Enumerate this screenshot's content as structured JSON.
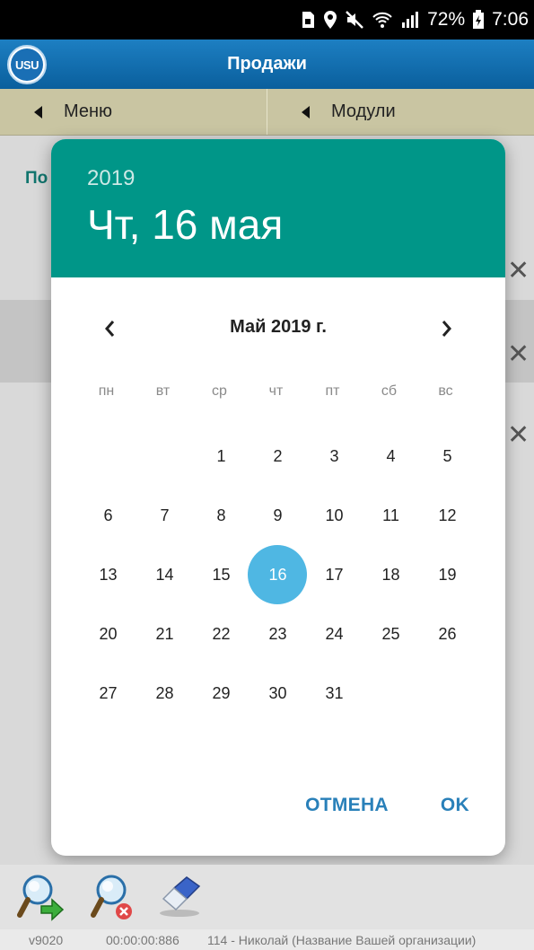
{
  "status_bar": {
    "battery": "72%",
    "time": "7:06"
  },
  "header": {
    "logo_text": "USU",
    "title": "Продажи"
  },
  "nav": {
    "menu_label": "Меню",
    "modules_label": "Модули"
  },
  "background": {
    "label_partial": "По"
  },
  "date_picker": {
    "year": "2019",
    "selected_date_text": "Чт, 16 мая",
    "month_title": "Май 2019 г.",
    "weekdays": [
      "пн",
      "вт",
      "ср",
      "чт",
      "пт",
      "сб",
      "вс"
    ],
    "weeks": [
      [
        "",
        "",
        "1",
        "2",
        "3",
        "4",
        "5"
      ],
      [
        "6",
        "7",
        "8",
        "9",
        "10",
        "11",
        "12"
      ],
      [
        "13",
        "14",
        "15",
        "16",
        "17",
        "18",
        "19"
      ],
      [
        "20",
        "21",
        "22",
        "23",
        "24",
        "25",
        "26"
      ],
      [
        "27",
        "28",
        "29",
        "30",
        "31",
        "",
        ""
      ]
    ],
    "selected_day": "16",
    "accent_color": "#009688",
    "selected_color": "#4fb7e3",
    "cancel_label": "ОТМЕНА",
    "ok_label": "OK"
  },
  "status_line": {
    "version": "v9020",
    "timer": "00:00:00:886",
    "user": "114 - Николай (Название Вашей организации)"
  }
}
